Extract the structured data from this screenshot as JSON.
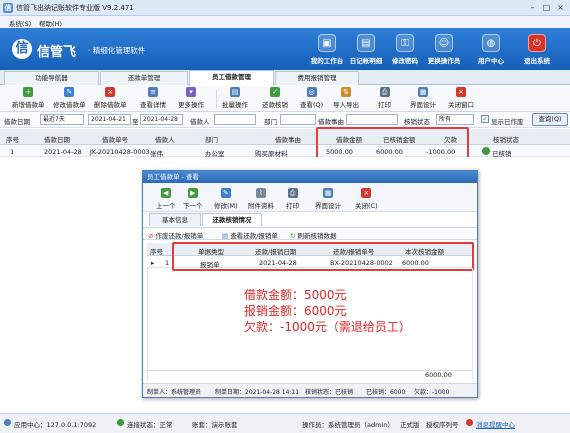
{
  "window": {
    "title": "信管飞出纳记账软件专业版 V9.2.471",
    "app_icon": "信"
  },
  "menubar": [
    "系统(S)",
    "帮助(H)"
  ],
  "brand": {
    "logo": "信",
    "name": "信管飞",
    "slogan": "· 精细化管理软件"
  },
  "top_tools": [
    {
      "label": "我的工作台",
      "icon": "desk-icon"
    },
    {
      "label": "日记帐明细",
      "icon": "ledger-icon"
    },
    {
      "label": "修改密码",
      "icon": "key-icon"
    },
    {
      "label": "更换操作员",
      "icon": "user-switch-icon"
    },
    {
      "label": "用户中心",
      "icon": "globe-icon"
    },
    {
      "label": "退出系统",
      "icon": "power-icon"
    }
  ],
  "tabs": [
    {
      "label": "功能导航器"
    },
    {
      "label": "还款单管理"
    },
    {
      "label": "员工借款管理",
      "active": true
    },
    {
      "label": "费用报销管理"
    }
  ],
  "toolbar": [
    {
      "label": "新增借款单",
      "glyph": "+",
      "color": "#3e9b3e"
    },
    {
      "label": "修改借款单",
      "glyph": "✎",
      "color": "#3f7fcf"
    },
    {
      "label": "删除借款单",
      "glyph": "×",
      "color": "#d0392b"
    },
    {
      "label": "查看详情",
      "glyph": "≡",
      "color": "#4f7fb8"
    },
    {
      "label": "更多操作",
      "glyph": "▾",
      "color": "#7a5fc0"
    },
    {
      "label": "批量操作",
      "glyph": "▤",
      "color": "#4f7fb8"
    },
    {
      "label": "还款核销",
      "glyph": "✓",
      "color": "#3e9b3e"
    },
    {
      "label": "查看(Q)",
      "glyph": "◎",
      "color": "#4f7fb8"
    },
    {
      "label": "导入导出",
      "glyph": "⇅",
      "color": "#d08a26"
    },
    {
      "label": "打印",
      "glyph": "⎙",
      "color": "#5c6f86"
    },
    {
      "label": "界面设计",
      "glyph": "▦",
      "color": "#4f7fb8"
    },
    {
      "label": "关闭窗口",
      "glyph": "×",
      "color": "#d0392b"
    }
  ],
  "filter": {
    "date_label": "借款日期",
    "date_range": "最近7天",
    "date_from": "2021-04-21",
    "to": "至",
    "date_to": "2021-04-28",
    "borrower_label": "借款人",
    "borrower_value": "",
    "dept_label": "部门",
    "dept_value": "",
    "reason_label": "借款事由",
    "reason_value": "",
    "status_label": "核销状态",
    "status_value": "所有",
    "show_writtenoff_label": "显示已作废",
    "query_label": "查询(Q)"
  },
  "grid": {
    "columns": [
      "序号",
      "借款日期",
      "借款单号",
      "借款人",
      "部门",
      "借款事由",
      "借款金额",
      "已核销金额",
      "欠款",
      "核销状态"
    ],
    "rows": [
      {
        "index": "1",
        "date": "2021-04-28",
        "number": "JK-20210428-0003",
        "borrower": "张伟",
        "dept": "办公室",
        "reason": "购买原材料",
        "amount": "5000.00",
        "written_off": "6000.00",
        "owed": "-1000.00",
        "status": "已核销"
      }
    ]
  },
  "dialog": {
    "title": "员工借款单 - 查看",
    "toolbar": [
      "上一个",
      "下一个",
      "修改(M)",
      "附件资料",
      "打印",
      "界面设计",
      "关闭(C)"
    ],
    "tabs": [
      {
        "label": "基本信息"
      },
      {
        "label": "还款核销情况",
        "active": true
      }
    ],
    "subtools": [
      "作废还款/报销单",
      "查看还款/报销单",
      "刷新核销数据"
    ],
    "columns": [
      "序号",
      "单据类型",
      "还款/报销日期",
      "还款/报销单号",
      "本次核销金额"
    ],
    "rows": [
      {
        "index": "1",
        "type": "报销单",
        "date": "2021-04-28",
        "number": "BX-20210428-0002",
        "amount": "6000.00"
      }
    ],
    "total": "6000.00",
    "footer": {
      "maker": "制单人：系统管理员",
      "make_date": "制单日期：2021-04-28 14:11",
      "status": "核销状态：已核销",
      "written_off": "已核销：6000",
      "owed": "欠款：-1000"
    }
  },
  "annotation": {
    "line1": "借款金额：5000元",
    "line2": "报销金额：6000元",
    "line3": "欠款：-1000元（需退给员工）"
  },
  "statusbar": {
    "app_center": "应用中心：127.0.0.1:7092",
    "connection": "连接状态：正常",
    "account": "账套：演示账套",
    "operator": "操作员：系统管理员（admin）",
    "edition": "正式版",
    "license": "授权序列号",
    "message": "消息提醒中心"
  }
}
